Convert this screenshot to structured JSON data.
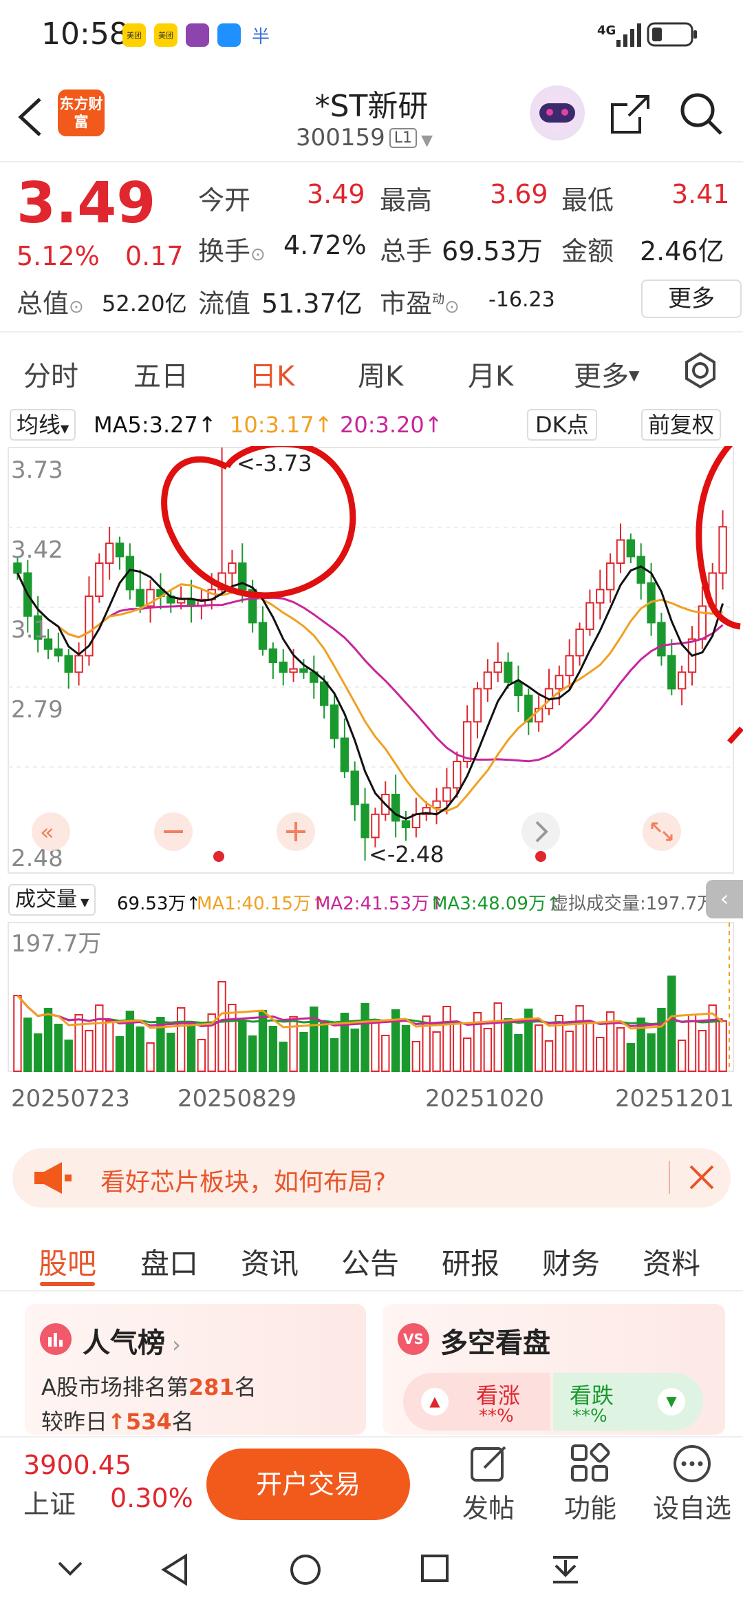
{
  "status": {
    "time": "10:58",
    "apps": [
      "美团",
      "美团",
      "",
      "",
      "半"
    ],
    "network": "4G"
  },
  "header": {
    "logo_text": "东方财富",
    "stock_name": "*ST新研",
    "stock_code": "300159",
    "board_badge": "L1"
  },
  "quote": {
    "price": "3.49",
    "change_pct": "5.12%",
    "change": "0.17",
    "open_label": "今开",
    "open": "3.49",
    "high_label": "最高",
    "high": "3.69",
    "low_label": "最低",
    "low": "3.41",
    "turnover_label": "换手",
    "turnover": "4.72%",
    "volume_label": "总手",
    "volume": "69.53万",
    "amount_label": "金额",
    "amount": "2.46亿",
    "mktcap_label": "总值",
    "mktcap": "52.20亿",
    "float_label": "流值",
    "float": "51.37亿",
    "pe_label": "市盈",
    "pe_sup": "动",
    "pe": "-16.23",
    "more_label": "更多"
  },
  "period_tabs": [
    "分时",
    "五日",
    "日K",
    "周K",
    "月K",
    "更多"
  ],
  "active_period": "日K",
  "kline": {
    "ma_selector": "均线",
    "ma5": "MA5:3.27↑",
    "ma10": "10:3.17↑",
    "ma20": "20:3.20↑",
    "dk_label": "DK点",
    "adjust_label": "前复权",
    "y_ticks": [
      "3.73",
      "3.42",
      "3.1",
      "2.79",
      "2.48"
    ],
    "high_marker": "<-3.73",
    "low_marker": "<-2.48",
    "colors": {
      "up": "#e0262e",
      "down": "#1a9a2e",
      "ma5": "#111111",
      "ma10": "#f0a020",
      "ma20": "#c8259a"
    }
  },
  "volume": {
    "selector": "成交量",
    "current": "69.53万↑",
    "ma1": "MA1:40.15万↑",
    "ma2": "MA2:41.53万↑",
    "ma3": "MA3:48.09万↑",
    "virtual": "虚拟成交量:197.7万",
    "max_label": "197.7万",
    "dates": [
      "20250723",
      "20250829",
      "20251020",
      "20251201"
    ]
  },
  "promo": {
    "text": "看好芯片板块，如何布局?"
  },
  "categories": [
    "股吧",
    "盘口",
    "资讯",
    "公告",
    "研报",
    "财务",
    "资料"
  ],
  "active_category": "股吧",
  "popularity": {
    "title": "人气榜",
    "rank_prefix": "A股市场排名第",
    "rank": "281",
    "rank_suffix": "名",
    "change_prefix": "较昨日",
    "change": "534",
    "change_suffix": "名"
  },
  "sentiment": {
    "title": "多空看盘",
    "bull_label": "看涨",
    "bull_value": "**%",
    "bear_label": "看跌",
    "bear_value": "**%"
  },
  "actionbar": {
    "index_value": "3900.45",
    "index_name": "上证",
    "index_change": "0.30%",
    "trade_button": "开户交易",
    "post_label": "发帖",
    "func_label": "功能",
    "watch_label": "设自选"
  }
}
